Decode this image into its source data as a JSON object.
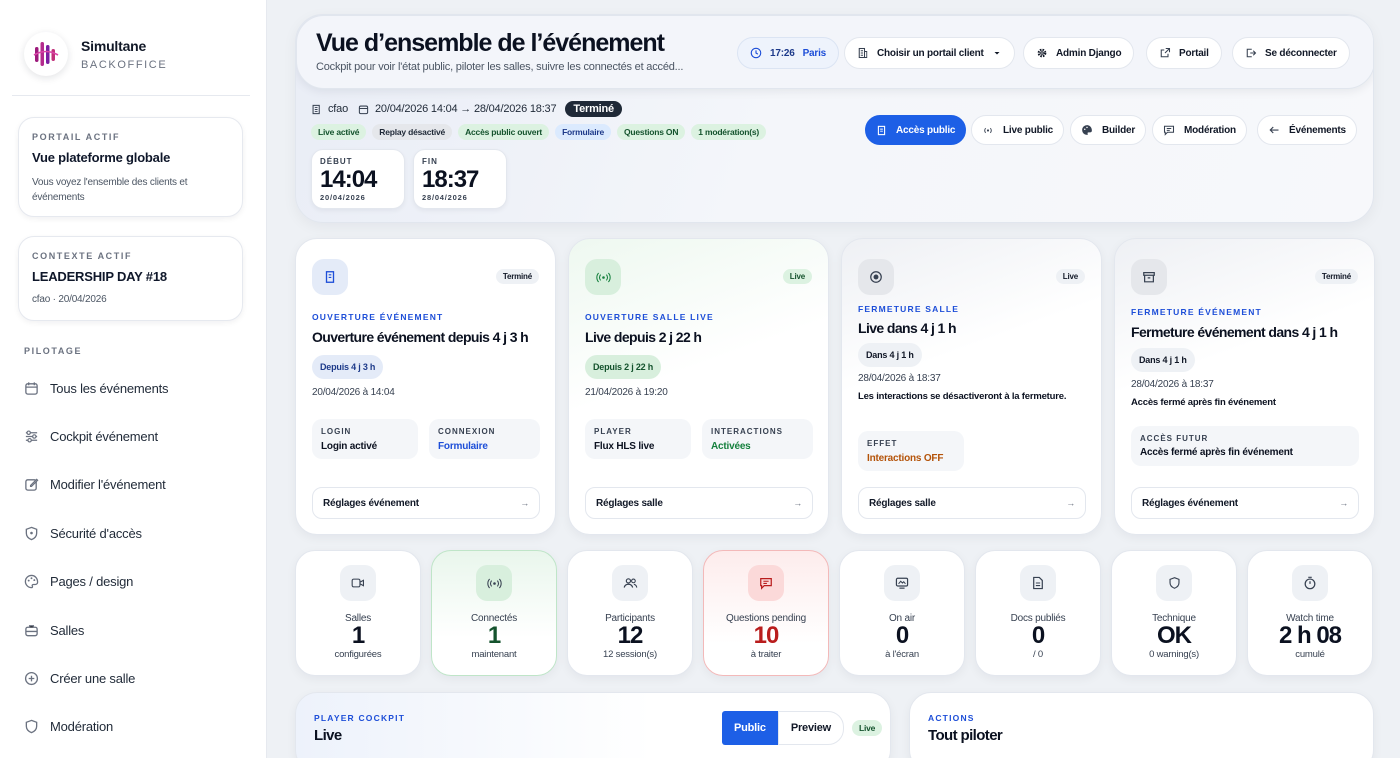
{
  "sidebar": {
    "brand_name": "Simultane",
    "brand_sub": "BACKOFFICE",
    "portal_card": {
      "kicker": "PORTAIL ACTIF",
      "title": "Vue plateforme globale",
      "desc": "Vous voyez l'ensemble des clients et événements"
    },
    "context_card": {
      "kicker": "CONTEXTE ACTIF",
      "title": "LEADERSHIP DAY #18",
      "desc": "cfao · 20/04/2026"
    },
    "section": "PILOTAGE",
    "items": [
      {
        "label": "Tous les événements",
        "icon": "calendar-icon"
      },
      {
        "label": "Cockpit événement",
        "icon": "sliders-icon"
      },
      {
        "label": "Modifier l'événement",
        "icon": "edit-icon"
      },
      {
        "label": "Sécurité d'accès",
        "icon": "shield-icon"
      },
      {
        "label": "Pages / design",
        "icon": "palette-icon"
      },
      {
        "label": "Salles",
        "icon": "briefcase-icon"
      },
      {
        "label": "Créer une salle",
        "icon": "plus-circle-icon"
      },
      {
        "label": "Modération",
        "icon": "shield-icon"
      }
    ]
  },
  "header": {
    "title": "Vue d’ensemble de l’événement",
    "subtitle": "Cockpit pour voir l'état public, piloter les salles, suivre les connectés et accéd...",
    "clock": {
      "time": "17:26",
      "zone": "Paris"
    },
    "portal_select": "Choisir un portail client",
    "admin": "Admin Django",
    "portal": "Portail",
    "logout": "Se déconnecter"
  },
  "event": {
    "org": "cfao",
    "dates": "20/04/2026 14:04 → 28/04/2026 18:37",
    "status": "Terminé",
    "badges": [
      {
        "label": "Live activé",
        "tone": "green"
      },
      {
        "label": "Replay désactivé",
        "tone": "gray"
      },
      {
        "label": "Accès public ouvert",
        "tone": "green"
      },
      {
        "label": "Formulaire",
        "tone": "blue"
      },
      {
        "label": "Questions ON",
        "tone": "green"
      },
      {
        "label": "1 modération(s)",
        "tone": "green"
      }
    ],
    "start": {
      "label": "DÉBUT",
      "time": "14:04",
      "date": "20/04/2026"
    },
    "end": {
      "label": "FIN",
      "time": "18:37",
      "date": "28/04/2026"
    },
    "actions": {
      "public_access": "Accès public",
      "live_public": "Live public",
      "builder": "Builder",
      "moderation": "Modération",
      "events": "Événements"
    }
  },
  "cards": [
    {
      "icon": "building-icon",
      "tag": "Terminé",
      "kicker": "OUVERTURE ÉVÉNEMENT",
      "title": "Ouverture événement depuis 4 j 3 h",
      "chip": "Depuis 4 j 3 h",
      "date": "20/04/2026 à 14:04",
      "info": [
        {
          "k": "LOGIN",
          "v": "Login activé"
        },
        {
          "k": "CONNEXION",
          "v": "Formulaire"
        }
      ],
      "button": "Réglages événement"
    },
    {
      "icon": "broadcast-icon",
      "tag": "Live",
      "kicker": "OUVERTURE SALLE LIVE",
      "title": "Live depuis 2 j 22 h",
      "chip": "Depuis 2 j 22 h",
      "date": "21/04/2026 à 19:20",
      "info": [
        {
          "k": "PLAYER",
          "v": "Flux HLS live"
        },
        {
          "k": "INTERACTIONS",
          "v": "Activées"
        }
      ],
      "button": "Réglages salle"
    },
    {
      "icon": "record-icon",
      "tag": "Live",
      "kicker": "FERMETURE SALLE",
      "title": "Live dans 4 j 1 h",
      "chip": "Dans 4 j 1 h",
      "date": "28/04/2026 à 18:37",
      "note": "Les interactions se désactiveront à la fermeture.",
      "info": [
        {
          "k": "EFFET",
          "v": "Interactions OFF"
        }
      ],
      "button": "Réglages salle"
    },
    {
      "icon": "archive-icon",
      "tag": "Terminé",
      "kicker": "FERMETURE ÉVÉNEMENT",
      "title": "Fermeture événement dans 4 j 1 h",
      "chip": "Dans 4 j 1 h",
      "date": "28/04/2026 à 18:37",
      "note": "Accès fermé après fin événement",
      "info": [
        {
          "k": "ACCÈS FUTUR",
          "v": "Accès fermé après fin événement"
        }
      ],
      "button": "Réglages événement"
    }
  ],
  "stats": [
    {
      "icon": "video-icon",
      "label": "Salles",
      "value": "1",
      "sub": "configurées"
    },
    {
      "icon": "broadcast-icon",
      "label": "Connectés",
      "value": "1",
      "sub": "maintenant"
    },
    {
      "icon": "users-icon",
      "label": "Participants",
      "value": "12",
      "sub": "12 session(s)"
    },
    {
      "icon": "message-icon",
      "label": "Questions pending",
      "value": "10",
      "sub": "à traiter"
    },
    {
      "icon": "screen-icon",
      "label": "On air",
      "value": "0",
      "sub": "à l'écran"
    },
    {
      "icon": "document-icon",
      "label": "Docs publiés",
      "value": "0",
      "sub": "/ 0"
    },
    {
      "icon": "shield-icon",
      "label": "Technique",
      "value": "OK",
      "sub": "0 warning(s)"
    },
    {
      "icon": "timer-icon",
      "label": "Watch time",
      "value": "2 h 08",
      "sub": "cumulé"
    }
  ],
  "player": {
    "kicker": "PLAYER COCKPIT",
    "title": "Live",
    "tab_public": "Public",
    "tab_preview": "Preview",
    "badge": "Live"
  },
  "actions_panel": {
    "kicker": "ACTIONS",
    "title": "Tout piloter"
  },
  "colors": {
    "accent": "#1d5fe6",
    "live_green": "#15803d",
    "alert_red": "#b91c1c"
  }
}
